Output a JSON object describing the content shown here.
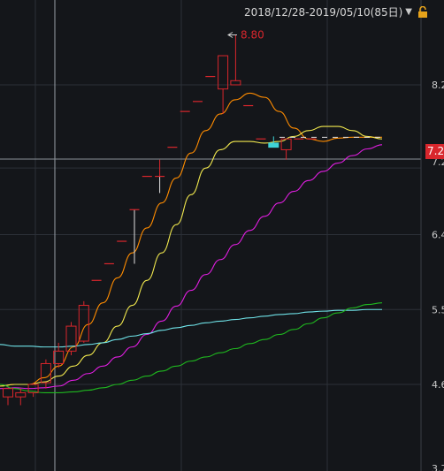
{
  "header": {
    "range_label": "2018/12/28-2019/05/10(85日)"
  },
  "colors": {
    "background": "#14161a",
    "up": "#d8262c",
    "down": "#3fd4d6",
    "ma_orange": "#ff8c00",
    "ma_yellow": "#f2e94e",
    "ma_magenta": "#e01ee0",
    "ma_cyan": "#6fe3e8",
    "ma_green": "#1fb81f"
  },
  "price_axis": {
    "labels": [
      "8.2",
      "7.2",
      "6.4",
      "5.5",
      "4.6",
      "3.7"
    ],
    "current_tag": "7.2"
  },
  "annotation": {
    "high_label": "8.80"
  },
  "chart_data": {
    "type": "candlestick",
    "ylim": [
      3.7,
      9.0
    ],
    "candles": [
      {
        "o": 4.45,
        "h": 4.55,
        "l": 4.35,
        "c": 4.55
      },
      {
        "o": 4.45,
        "h": 4.55,
        "l": 4.35,
        "c": 4.5
      },
      {
        "o": 4.5,
        "h": 4.62,
        "l": 4.45,
        "c": 4.6
      },
      {
        "o": 4.62,
        "h": 4.9,
        "l": 4.55,
        "c": 4.85
      },
      {
        "o": 4.85,
        "h": 5.1,
        "l": 4.8,
        "c": 5.0
      },
      {
        "o": 5.0,
        "h": 5.35,
        "l": 4.95,
        "c": 5.3
      },
      {
        "o": 5.12,
        "h": 5.6,
        "l": 5.1,
        "c": 5.55
      },
      {
        "o": 5.85,
        "h": 5.85,
        "l": 5.85,
        "c": 5.85
      },
      {
        "o": 6.05,
        "h": 6.05,
        "l": 6.05,
        "c": 6.05
      },
      {
        "o": 6.32,
        "h": 6.32,
        "l": 6.32,
        "c": 6.32
      },
      {
        "o": 6.7,
        "h": 6.7,
        "l": 6.05,
        "c": 6.7
      },
      {
        "o": 7.1,
        "h": 7.1,
        "l": 7.1,
        "c": 7.1
      },
      {
        "o": 7.1,
        "h": 7.3,
        "l": 6.9,
        "c": 7.1
      },
      {
        "o": 7.45,
        "h": 7.45,
        "l": 7.45,
        "c": 7.45
      },
      {
        "o": 7.88,
        "h": 7.88,
        "l": 7.88,
        "c": 7.88
      },
      {
        "o": 8.0,
        "h": 8.0,
        "l": 8.0,
        "c": 8.0
      },
      {
        "o": 8.3,
        "h": 8.3,
        "l": 8.3,
        "c": 8.3
      },
      {
        "o": 8.15,
        "h": 8.55,
        "l": 7.85,
        "c": 8.55
      },
      {
        "o": 8.2,
        "h": 8.8,
        "l": 8.2,
        "c": 8.25
      },
      {
        "o": 7.95,
        "h": 7.95,
        "l": 7.95,
        "c": 7.95
      },
      {
        "o": 7.55,
        "h": 7.55,
        "l": 7.55,
        "c": 7.55
      },
      {
        "o": 7.5,
        "h": 7.58,
        "l": 7.45,
        "c": 7.45
      },
      {
        "o": 7.42,
        "h": 7.55,
        "l": 7.3,
        "c": 7.55
      },
      {
        "o": 7.55,
        "h": 7.55,
        "l": 7.55,
        "c": 7.55
      },
      {
        "o": 7.55,
        "h": 7.55,
        "l": 7.55,
        "c": 7.55
      }
    ],
    "series": [
      {
        "color": "#ff8c00",
        "values": [
          4.58,
          4.6,
          4.6,
          4.68,
          4.82,
          5.05,
          5.32,
          5.58,
          5.88,
          6.18,
          6.48,
          6.78,
          7.08,
          7.38,
          7.65,
          7.85,
          8.02,
          8.1,
          8.05,
          7.88,
          7.68,
          7.55,
          7.52,
          7.56,
          7.57,
          7.57,
          7.57
        ]
      },
      {
        "color": "#f2e94e",
        "values": [
          4.58,
          4.6,
          4.6,
          4.63,
          4.7,
          4.82,
          4.95,
          5.1,
          5.3,
          5.55,
          5.85,
          6.18,
          6.52,
          6.88,
          7.2,
          7.42,
          7.52,
          7.52,
          7.5,
          7.52,
          7.58,
          7.65,
          7.7,
          7.7,
          7.65,
          7.58,
          7.55
        ]
      },
      {
        "color": "#e01ee0",
        "values": [
          4.55,
          4.56,
          4.55,
          4.56,
          4.58,
          4.65,
          4.73,
          4.82,
          4.93,
          5.05,
          5.2,
          5.36,
          5.54,
          5.73,
          5.92,
          6.1,
          6.28,
          6.45,
          6.62,
          6.78,
          6.92,
          7.05,
          7.16,
          7.26,
          7.35,
          7.43,
          7.48
        ]
      },
      {
        "color": "#6fe3e8",
        "values": [
          5.08,
          5.06,
          5.06,
          5.05,
          5.05,
          5.06,
          5.08,
          5.1,
          5.14,
          5.18,
          5.21,
          5.25,
          5.28,
          5.31,
          5.34,
          5.36,
          5.38,
          5.4,
          5.42,
          5.44,
          5.45,
          5.47,
          5.48,
          5.49,
          5.49,
          5.5,
          5.5
        ]
      },
      {
        "color": "#1fb81f",
        "values": [
          4.6,
          4.55,
          4.52,
          4.5,
          4.5,
          4.51,
          4.53,
          4.56,
          4.6,
          4.65,
          4.7,
          4.76,
          4.82,
          4.88,
          4.93,
          4.98,
          5.03,
          5.09,
          5.14,
          5.2,
          5.26,
          5.33,
          5.4,
          5.46,
          5.52,
          5.56,
          5.58
        ]
      }
    ]
  }
}
